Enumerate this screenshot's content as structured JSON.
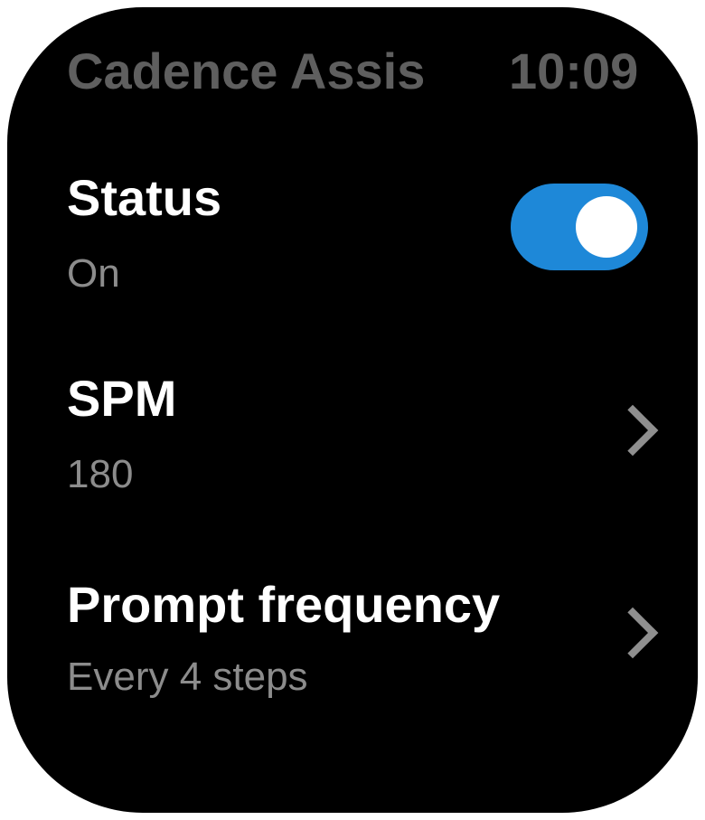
{
  "header": {
    "app_title": "Cadence Assis",
    "time": "10:09"
  },
  "status": {
    "title": "Status",
    "value": "On",
    "toggle_on": true,
    "toggle_color": "#1e88d8"
  },
  "spm": {
    "title": "SPM",
    "value": "180",
    "icon": "chevron-right-icon"
  },
  "prompt_frequency": {
    "title": "Prompt frequency",
    "value": "Every  4 steps",
    "icon": "chevron-right-icon"
  }
}
